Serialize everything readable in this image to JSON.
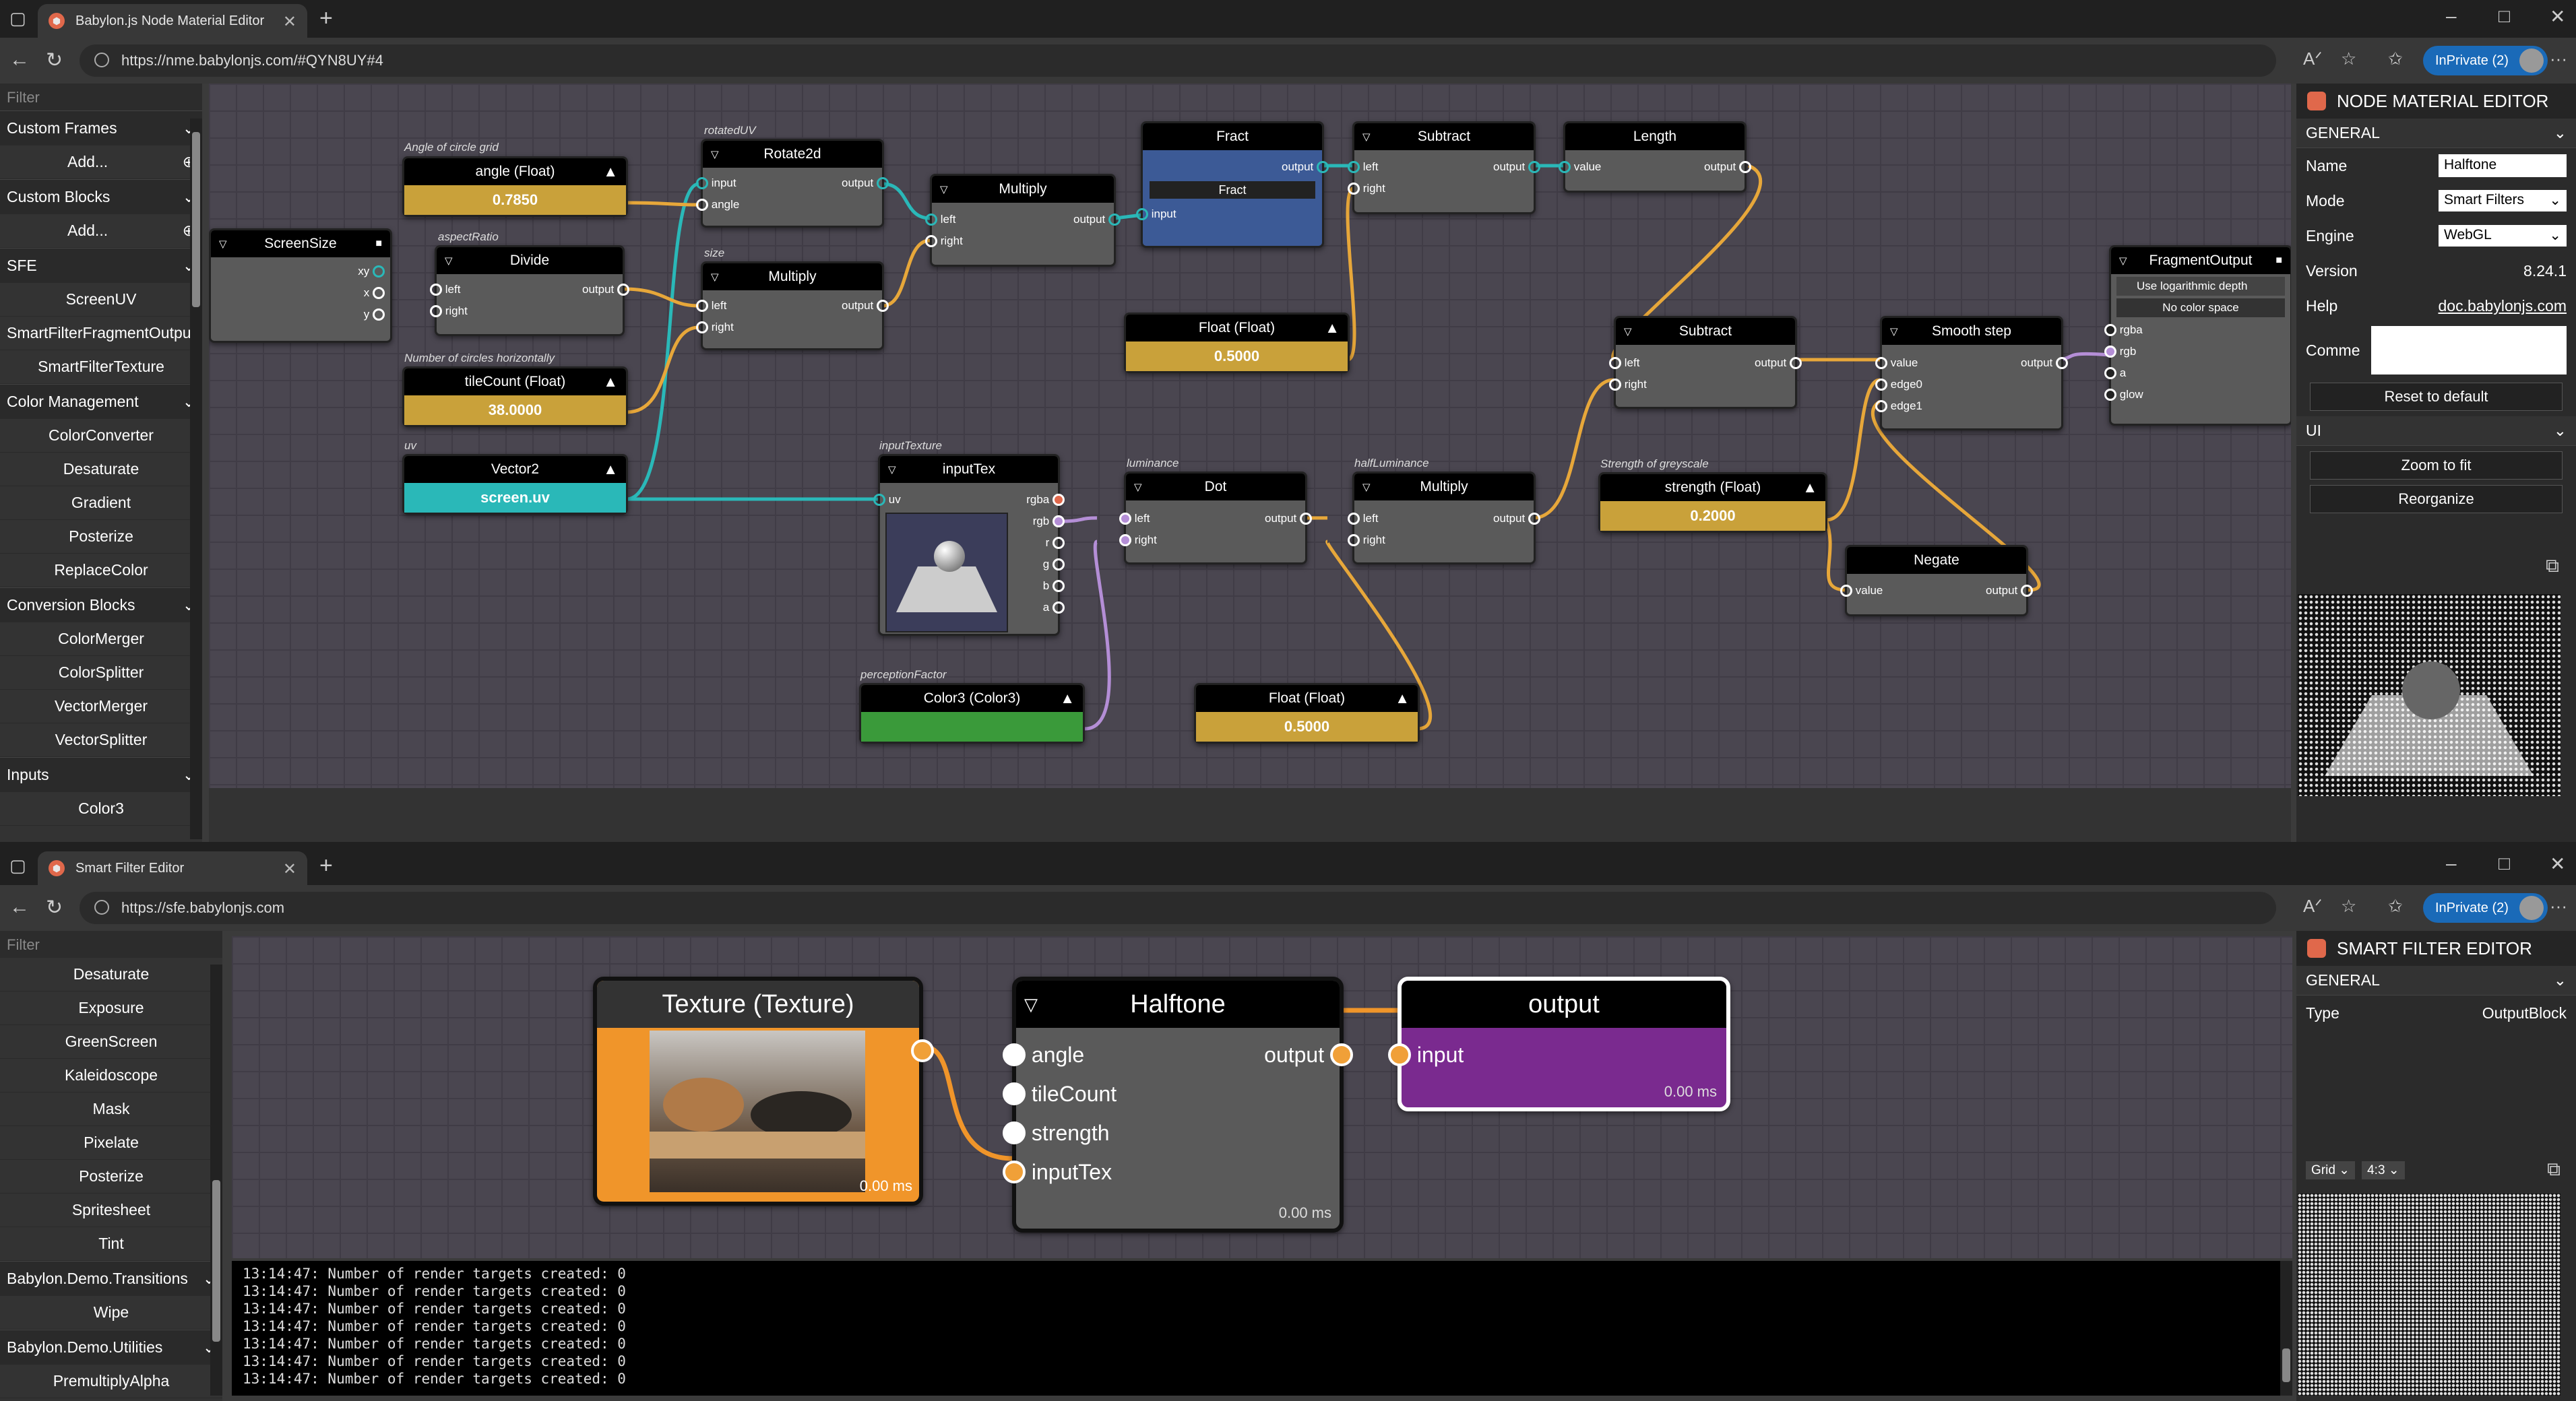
{
  "top": {
    "tab_title": "Babylon.js Node Material Editor",
    "url": "https://nme.babylonjs.com/#QYN8UY#4",
    "private_label": "InPrivate (2)",
    "filter_placeholder": "Filter",
    "sidebar": [
      {
        "type": "cat",
        "label": "Custom Frames"
      },
      {
        "type": "add",
        "label": "Add..."
      },
      {
        "type": "cat",
        "label": "Custom Blocks"
      },
      {
        "type": "add",
        "label": "Add..."
      },
      {
        "type": "cat",
        "label": "SFE"
      },
      {
        "type": "item",
        "label": "ScreenUV"
      },
      {
        "type": "item",
        "label": "SmartFilterFragmentOutput"
      },
      {
        "type": "item",
        "label": "SmartFilterTexture"
      },
      {
        "type": "cat",
        "label": "Color Management"
      },
      {
        "type": "item",
        "label": "ColorConverter"
      },
      {
        "type": "item",
        "label": "Desaturate"
      },
      {
        "type": "item",
        "label": "Gradient"
      },
      {
        "type": "item",
        "label": "Posterize"
      },
      {
        "type": "item",
        "label": "ReplaceColor"
      },
      {
        "type": "cat",
        "label": "Conversion Blocks"
      },
      {
        "type": "item",
        "label": "ColorMerger"
      },
      {
        "type": "item",
        "label": "ColorSplitter"
      },
      {
        "type": "item",
        "label": "VectorMerger"
      },
      {
        "type": "item",
        "label": "VectorSplitter"
      },
      {
        "type": "cat",
        "label": "Inputs"
      },
      {
        "type": "item",
        "label": "Color3"
      }
    ],
    "nodes": {
      "angle": {
        "title": "angle (Float)",
        "value": "0.7850",
        "comment": "Angle of circle grid"
      },
      "screensize": {
        "title": "ScreenSize",
        "ports": [
          "xy",
          "x",
          "y"
        ]
      },
      "divide": {
        "title": "Divide",
        "comment": "aspectRatio",
        "in": [
          "left",
          "right"
        ],
        "out": "output"
      },
      "tilecount": {
        "title": "tileCount (Float)",
        "value": "38.0000",
        "comment": "Number of circles horizontally"
      },
      "vector2": {
        "title": "Vector2",
        "value": "screen.uv",
        "comment": "uv"
      },
      "rotate2d": {
        "title": "Rotate2d",
        "comment": "rotatedUV",
        "in": [
          "input",
          "angle"
        ],
        "out": "output"
      },
      "multiply1": {
        "title": "Multiply",
        "comment": "size",
        "in": [
          "left",
          "right"
        ],
        "out": "output"
      },
      "multiply2": {
        "title": "Multiply",
        "in": [
          "left",
          "right"
        ],
        "out": "output"
      },
      "fract": {
        "title": "Fract",
        "sub": "Fract",
        "in": [
          "input"
        ],
        "out": "output"
      },
      "subtract1": {
        "title": "Subtract",
        "in": [
          "left",
          "right"
        ],
        "out": "output"
      },
      "length": {
        "title": "Length",
        "in": [
          "value"
        ],
        "out": "output"
      },
      "float1": {
        "title": "Float (Float)",
        "value": "0.5000"
      },
      "inputtex": {
        "title": "inputTex",
        "comment": "inputTexture",
        "in": [
          "uv"
        ],
        "out": [
          "rgba",
          "rgb",
          "r",
          "g",
          "b",
          "a"
        ]
      },
      "dot": {
        "title": "Dot",
        "comment": "luminance",
        "in": [
          "left",
          "right"
        ],
        "out": "output"
      },
      "multiply3": {
        "title": "Multiply",
        "comment": "halfLuminance",
        "in": [
          "left",
          "right"
        ],
        "out": "output"
      },
      "color3": {
        "title": "Color3 (Color3)",
        "comment": "perceptionFactor"
      },
      "float2": {
        "title": "Float (Float)",
        "value": "0.5000"
      },
      "subtract2": {
        "title": "Subtract",
        "in": [
          "left",
          "right"
        ],
        "out": "output"
      },
      "strength": {
        "title": "strength (Float)",
        "value": "0.2000",
        "comment": "Strength of greyscale"
      },
      "smoothstep": {
        "title": "Smooth step",
        "in": [
          "value",
          "edge0",
          "edge1"
        ],
        "out": "output"
      },
      "negate": {
        "title": "Negate",
        "in": [
          "value"
        ],
        "out": "output"
      },
      "fragout": {
        "title": "FragmentOutput",
        "opt1": "Use logarithmic depth",
        "opt2": "No color space",
        "in": [
          "rgba",
          "rgb",
          "a",
          "glow"
        ]
      }
    },
    "panel": {
      "title": "NODE MATERIAL EDITOR",
      "general": "GENERAL",
      "name_label": "Name",
      "name_value": "Halftone",
      "mode_label": "Mode",
      "mode_value": "Smart Filters",
      "engine_label": "Engine",
      "engine_value": "WebGL",
      "version_label": "Version",
      "version_value": "8.24.1",
      "help_label": "Help",
      "help_value": "doc.babylonjs.com",
      "comment_label": "Comme",
      "reset": "Reset to default",
      "ui": "UI",
      "zoom": "Zoom to fit",
      "reorganize": "Reorganize"
    }
  },
  "bottom": {
    "tab_title": "Smart Filter Editor",
    "url": "https://sfe.babylonjs.com",
    "private_label": "InPrivate (2)",
    "filter_placeholder": "Filter",
    "sidebar": [
      {
        "type": "item",
        "label": "Desaturate"
      },
      {
        "type": "item",
        "label": "Exposure"
      },
      {
        "type": "item",
        "label": "GreenScreen"
      },
      {
        "type": "item",
        "label": "Kaleidoscope"
      },
      {
        "type": "item",
        "label": "Mask"
      },
      {
        "type": "item",
        "label": "Pixelate"
      },
      {
        "type": "item",
        "label": "Posterize"
      },
      {
        "type": "item",
        "label": "Spritesheet"
      },
      {
        "type": "item",
        "label": "Tint"
      },
      {
        "type": "cat",
        "label": "Babylon.Demo.Transitions"
      },
      {
        "type": "item",
        "label": "Wipe"
      },
      {
        "type": "cat",
        "label": "Babylon.Demo.Utilities"
      },
      {
        "type": "item",
        "label": "PremultiplyAlpha"
      }
    ],
    "nodes": {
      "texture": {
        "title": "Texture (Texture)",
        "ms": "0.00 ms"
      },
      "halftone": {
        "title": "Halftone",
        "in": [
          "angle",
          "tileCount",
          "strength",
          "inputTex"
        ],
        "out": "output",
        "ms": "0.00 ms"
      },
      "output": {
        "title": "output",
        "in": "input",
        "ms": "0.00 ms"
      }
    },
    "log": [
      "13:14:47: Number of render targets created: 0",
      "13:14:47: Number of render targets created: 0",
      "13:14:47: Number of render targets created: 0",
      "13:14:47: Number of render targets created: 0",
      "13:14:47: Number of render targets created: 0",
      "13:14:47: Number of render targets created: 0",
      "13:14:47: Number of render targets created: 0"
    ],
    "panel": {
      "title": "SMART FILTER EDITOR",
      "general": "GENERAL",
      "type_label": "Type",
      "type_value": "OutputBlock",
      "grid_sel": "Grid",
      "ratio_sel": "4:3"
    }
  },
  "colors": {
    "float": "#c9a13a",
    "vec": "#2ab8b8",
    "color": "#3a9a3a",
    "fract": "#3c5a96",
    "wire_teal": "#2ab8b8",
    "wire_orange": "#e7a73a",
    "wire_purple": "#b48ed6",
    "sfe_orange": "#f0952a",
    "sfe_purple": "#7a2a8f"
  }
}
